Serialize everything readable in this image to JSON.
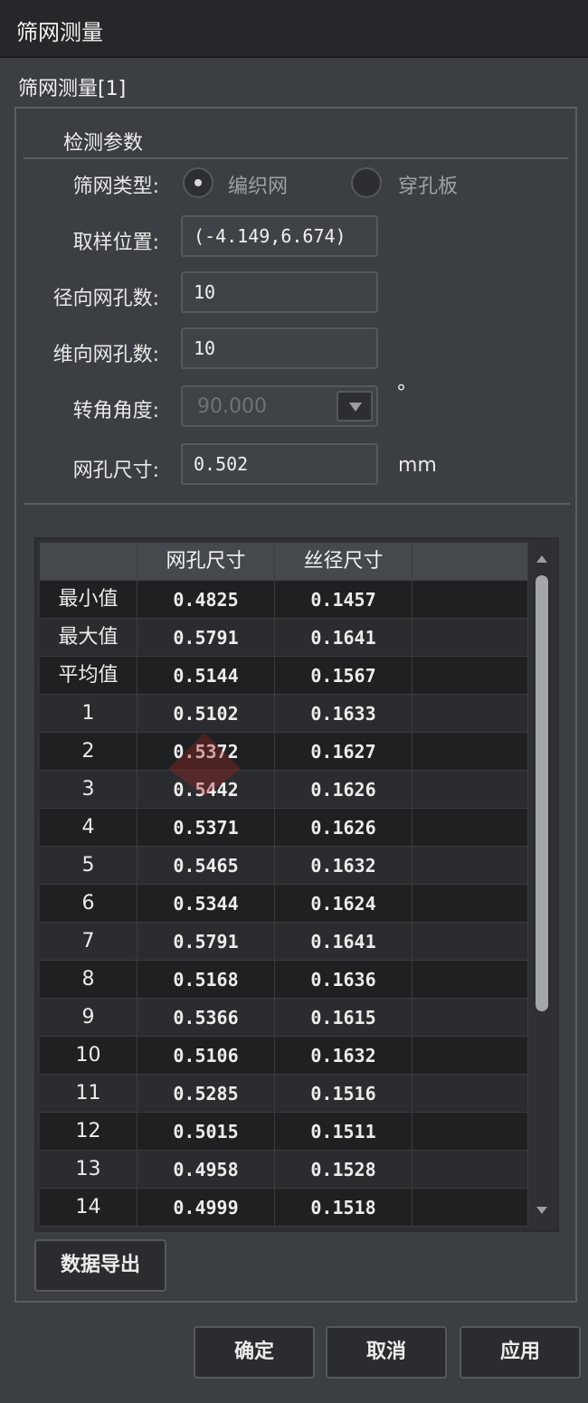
{
  "window": {
    "title": "筛网测量"
  },
  "panel": {
    "title": "筛网测量[1]"
  },
  "params": {
    "section_title": "检测参数",
    "mesh_type": {
      "label": "筛网类型:",
      "options": [
        "编织网",
        "穿孔板"
      ],
      "selected": "编织网"
    },
    "sample_position": {
      "label": "取样位置:",
      "value": "(-4.149,6.674)"
    },
    "radial_count": {
      "label": "径向网孔数:",
      "value": "10"
    },
    "weft_count": {
      "label": "维向网孔数:",
      "value": "10"
    },
    "rotation_angle": {
      "label": "转角角度:",
      "value": "90.000",
      "unit": "°",
      "enabled": false
    },
    "hole_size": {
      "label": "网孔尺寸:",
      "value": "0.502",
      "unit": "mm"
    }
  },
  "table": {
    "columns": [
      "",
      "网孔尺寸",
      "丝径尺寸",
      ""
    ],
    "rows": [
      [
        "最小值",
        "0.4825",
        "0.1457"
      ],
      [
        "最大值",
        "0.5791",
        "0.1641"
      ],
      [
        "平均值",
        "0.5144",
        "0.1567"
      ],
      [
        "1",
        "0.5102",
        "0.1633"
      ],
      [
        "2",
        "0.5372",
        "0.1627"
      ],
      [
        "3",
        "0.5442",
        "0.1626"
      ],
      [
        "4",
        "0.5371",
        "0.1626"
      ],
      [
        "5",
        "0.5465",
        "0.1632"
      ],
      [
        "6",
        "0.5344",
        "0.1624"
      ],
      [
        "7",
        "0.5791",
        "0.1641"
      ],
      [
        "8",
        "0.5168",
        "0.1636"
      ],
      [
        "9",
        "0.5366",
        "0.1615"
      ],
      [
        "10",
        "0.5106",
        "0.1632"
      ],
      [
        "11",
        "0.5285",
        "0.1516"
      ],
      [
        "12",
        "0.5015",
        "0.1511"
      ],
      [
        "13",
        "0.4958",
        "0.1528"
      ],
      [
        "14",
        "0.4999",
        "0.1518"
      ]
    ]
  },
  "buttons": {
    "export": "数据导出",
    "ok": "确定",
    "cancel": "取消",
    "apply": "应用"
  }
}
